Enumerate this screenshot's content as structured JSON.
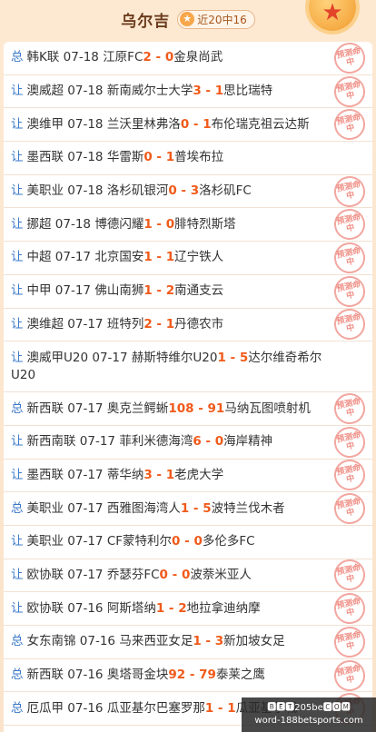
{
  "header": {
    "title": "乌尔吉",
    "badge_text": "近20中16",
    "badge_icon": "star-icon",
    "medal_icon": "medal-icon"
  },
  "colors": {
    "type": "#3a78c8",
    "score": "#f05a1a",
    "stamp": "#ef8f86"
  },
  "stamp_label": "预测命中",
  "rows": [
    {
      "type": "总",
      "league": "韩K联",
      "date": "07-18",
      "home": "江原FC",
      "hs": "2",
      "sep": " - ",
      "as": "0",
      "away": "金泉尚武",
      "hit": true
    },
    {
      "type": "让",
      "league": "澳威超",
      "date": "07-18",
      "home": "新南威尔士大学",
      "hs": "3",
      "sep": " - ",
      "as": "1",
      "away": "思比瑞特",
      "hit": true
    },
    {
      "type": "让",
      "league": "澳维甲",
      "date": "07-18",
      "home": "兰沃里林弗洛",
      "hs": "0",
      "sep": " - ",
      "as": "1",
      "away": "布伦瑞克祖云达斯",
      "hit": true
    },
    {
      "type": "让",
      "league": "墨西联",
      "date": "07-18",
      "home": "华雷斯",
      "hs": "0",
      "sep": " - ",
      "as": "1",
      "away": "普埃布拉",
      "hit": false
    },
    {
      "type": "让",
      "league": "美职业",
      "date": "07-18",
      "home": "洛杉矶银河",
      "hs": "0",
      "sep": " - ",
      "as": "3",
      "away": "洛杉矶FC",
      "hit": true
    },
    {
      "type": "让",
      "league": "挪超",
      "date": "07-18",
      "home": "博德闪耀",
      "hs": "1",
      "sep": " - ",
      "as": "0",
      "away": "腓特烈斯塔",
      "hit": true
    },
    {
      "type": "让",
      "league": "中超",
      "date": "07-17",
      "home": "北京国安",
      "hs": "1",
      "sep": " - ",
      "as": "1",
      "away": "辽宁铁人",
      "hit": true
    },
    {
      "type": "让",
      "league": "中甲",
      "date": "07-17",
      "home": "佛山南狮",
      "hs": "1",
      "sep": " - ",
      "as": "2",
      "away": "南通支云",
      "hit": true
    },
    {
      "type": "让",
      "league": "澳维超",
      "date": "07-17",
      "home": "班特列",
      "hs": "2",
      "sep": " - ",
      "as": "1",
      "away": "丹德农市",
      "hit": true
    },
    {
      "type": "让",
      "league": "澳威甲U20",
      "date": "07-17",
      "home": "赫斯特维尔U20",
      "hs": "1",
      "sep": " - ",
      "as": "5",
      "away": "达尔维奇希尔U20",
      "hit": false,
      "tall": true
    },
    {
      "type": "总",
      "league": "新西联",
      "date": "07-17",
      "home": "奥克兰鳄蜥",
      "hs": "108",
      "sep": " - ",
      "as": "91",
      "away": "马纳瓦图喷射机",
      "hit": true
    },
    {
      "type": "让",
      "league": "新西南联",
      "date": "07-17",
      "home": "菲利米德海湾",
      "hs": "6",
      "sep": " - ",
      "as": "0",
      "away": "海岸精神",
      "hit": true
    },
    {
      "type": "让",
      "league": "墨西联",
      "date": "07-17",
      "home": "蒂华纳",
      "hs": "3",
      "sep": " - ",
      "as": "1",
      "away": "老虎大学",
      "hit": true
    },
    {
      "type": "总",
      "league": "美职业",
      "date": "07-17",
      "home": "西雅图海湾人",
      "hs": "1",
      "sep": " - ",
      "as": "5",
      "away": "波特兰伐木者",
      "hit": true
    },
    {
      "type": "让",
      "league": "美职业",
      "date": "07-17",
      "home": "CF蒙特利尔",
      "hs": "0",
      "sep": " - ",
      "as": "0",
      "away": "多伦多FC",
      "hit": false
    },
    {
      "type": "让",
      "league": "欧协联",
      "date": "07-17",
      "home": "乔瑟芬FC",
      "hs": "0",
      "sep": " - ",
      "as": "0",
      "away": "波萘米亚人",
      "hit": true
    },
    {
      "type": "让",
      "league": "欧协联",
      "date": "07-16",
      "home": "阿斯塔纳",
      "hs": "1",
      "sep": " - ",
      "as": "2",
      "away": "地拉拿迪纳摩",
      "hit": true
    },
    {
      "type": "总",
      "league": "女东南锦",
      "date": "07-16",
      "home": "马来西亚女足",
      "hs": "1",
      "sep": " - ",
      "as": "3",
      "away": "新加坡女足",
      "hit": true
    },
    {
      "type": "总",
      "league": "新西联",
      "date": "07-16",
      "home": "奥塔哥金块",
      "hs": "92",
      "sep": " - ",
      "as": "79",
      "away": "泰莱之鹰",
      "hit": true
    },
    {
      "type": "总",
      "league": "厄瓜甲",
      "date": "07-16",
      "home": "瓜亚基尔巴塞罗那",
      "hs": "1",
      "sep": " - ",
      "as": "1",
      "away": "瓜亚基尔城",
      "hit": true
    }
  ],
  "watermark": {
    "line1": "🅱🅴🆃205be🅲🅾🅼",
    "line2": "word-188betsports.com"
  }
}
